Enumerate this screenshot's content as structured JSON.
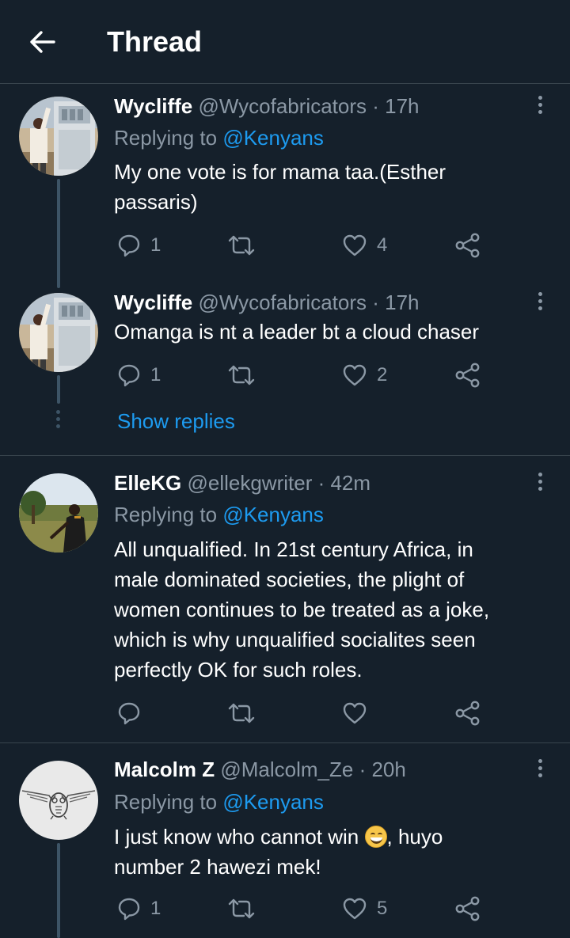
{
  "header": {
    "title": "Thread"
  },
  "tweets": [
    {
      "name": "Wycliffe",
      "handle": "@Wycofabricators · 17h",
      "replying_prefix": "Replying to ",
      "replying_to": "@Kenyans",
      "text_lines": [
        "My one vote is for mama taa.(Esther",
        "passaris)"
      ],
      "replies": "1",
      "retweets": "",
      "likes": "4"
    },
    {
      "name": "Wycliffe",
      "handle": "@Wycofabricators · 17h",
      "text_lines": [
        "Omanga is nt a leader bt a cloud chaser"
      ],
      "replies": "1",
      "retweets": "",
      "likes": "2",
      "show_replies": "Show replies"
    },
    {
      "name": "ElleKG",
      "handle": "@ellekgwriter · 42m",
      "replying_prefix": "Replying to ",
      "replying_to": "@Kenyans",
      "text_lines": [
        "All unqualified. In 21st century Africa, in",
        "male dominated societies, the plight of",
        "women continues to be treated as a joke,",
        "which is why unqualified socialites seen",
        "perfectly OK for such roles."
      ],
      "replies": "",
      "retweets": "",
      "likes": ""
    },
    {
      "name": "Malcolm Z",
      "handle": "@Malcolm_Ze · 20h",
      "replying_prefix": "Replying to ",
      "replying_to": "@Kenyans",
      "text_line1_before": "I just know who cannot win ",
      "text_line1_after": ", huyo",
      "text_line2": "number 2 hawezi mek!",
      "replies": "1",
      "retweets": "",
      "likes": "5"
    }
  ],
  "icons": {
    "back": "arrow-left-icon",
    "more": "more-vertical-icon",
    "reply": "comment-icon",
    "retweet": "retweet-icon",
    "like": "heart-icon",
    "share": "share-icon",
    "emoji": "grinning-squinting-face"
  },
  "colors": {
    "background": "#15202b",
    "divider": "#38444d",
    "secondary_text": "#8b98a5",
    "accent": "#1d9bf0"
  }
}
